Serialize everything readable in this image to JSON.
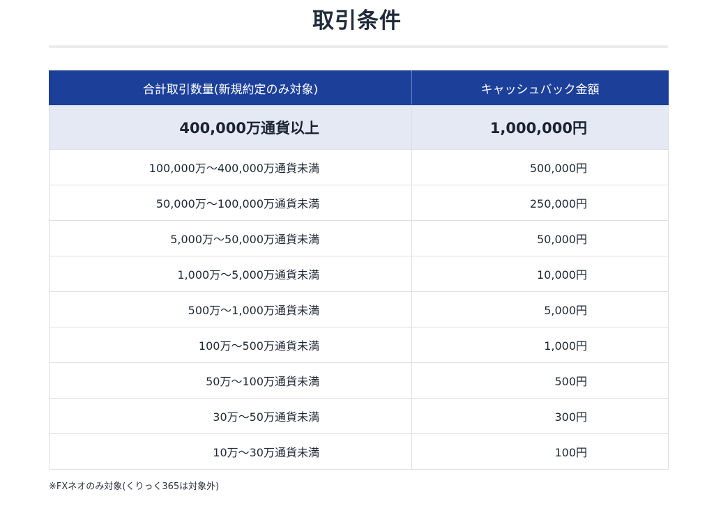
{
  "title": "取引条件",
  "table": {
    "headers": [
      "合計取引数量(新規約定のみ対象)",
      "キャッシュバック金額"
    ],
    "featured_row": {
      "volume": "400,000万通貨以上",
      "amount": "1,000,000円"
    },
    "rows": [
      {
        "volume": "100,000万〜400,000万通貨未満",
        "amount": "500,000円"
      },
      {
        "volume": "50,000万〜100,000万通貨未満",
        "amount": "250,000円"
      },
      {
        "volume": "5,000万〜50,000万通貨未満",
        "amount": "50,000円"
      },
      {
        "volume": "1,000万〜5,000万通貨未満",
        "amount": "10,000円"
      },
      {
        "volume": "500万〜1,000万通貨未満",
        "amount": "5,000円"
      },
      {
        "volume": "100万〜500万通貨未満",
        "amount": "1,000円"
      },
      {
        "volume": "50万〜100万通貨未満",
        "amount": "500円"
      },
      {
        "volume": "30万〜50万通貨未満",
        "amount": "300円"
      },
      {
        "volume": "10万〜30万通貨未満",
        "amount": "100円"
      }
    ]
  },
  "footnote": "※FXネオのみ対象(くりっく365は対象外)",
  "colors": {
    "header_bg": "#1c409a",
    "featured_bg": "#e4e9f3",
    "border": "#dcdfe5"
  }
}
